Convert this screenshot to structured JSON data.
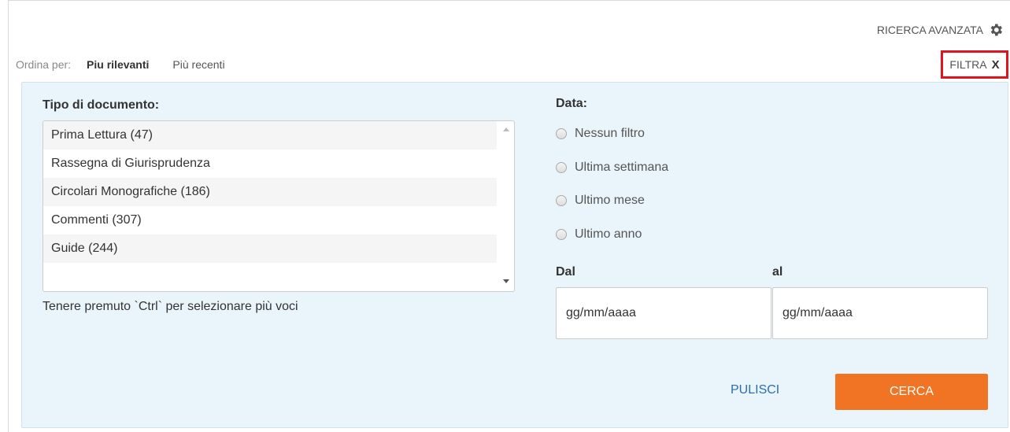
{
  "header": {
    "advanced_search_label": "RICERCA AVANZATA",
    "advanced_search_icon": "gear-icon"
  },
  "sort": {
    "label": "Ordina per:",
    "options": [
      "Piu rilevanti",
      "Più recenti"
    ],
    "active": "Piu rilevanti"
  },
  "filter_toggle": {
    "label": "FILTRA",
    "close": "X",
    "highlight_color": "#e0141e"
  },
  "filters": {
    "doc_type": {
      "label": "Tipo di documento:",
      "items": [
        "Prima Lettura (47)",
        "Rassegna di Giurisprudenza",
        "Circolari Monografiche (186)",
        "Commenti (307)",
        "Guide (244)"
      ],
      "hint": "Tenere premuto `Ctrl` per selezionare più voci"
    },
    "date": {
      "label": "Data:",
      "options": [
        "Nessun filtro",
        "Ultima settimana",
        "Ultimo mese",
        "Ultimo anno"
      ],
      "from_label": "Dal",
      "to_label": "al",
      "from_value": "gg/mm/aaaa",
      "to_value": "gg/mm/aaaa"
    }
  },
  "actions": {
    "clear_label": "PULISCI",
    "search_label": "CERCA",
    "search_color": "#f07423",
    "clear_color": "#2a6db5"
  }
}
